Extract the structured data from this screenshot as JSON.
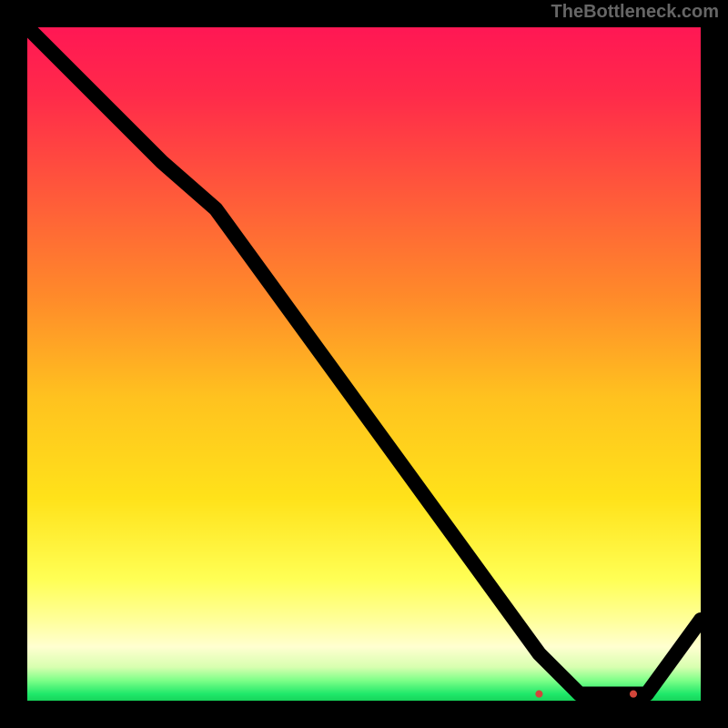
{
  "watermark": "TheBottleneck.com",
  "chart_data": {
    "type": "line",
    "title": "",
    "xlabel": "",
    "ylabel": "",
    "xlim": [
      0,
      100
    ],
    "ylim": [
      0,
      100
    ],
    "grid": false,
    "legend": false,
    "series": [
      {
        "name": "curve",
        "x": [
          0,
          10,
          20,
          28,
          36,
          44,
          52,
          60,
          68,
          76,
          82,
          88,
          92,
          100
        ],
        "y": [
          100,
          90,
          80,
          73,
          62,
          51,
          40,
          29,
          18,
          7,
          1,
          1,
          1,
          12
        ]
      }
    ],
    "annotations": [
      {
        "type": "marker-run",
        "name": "bottom-marker-cluster",
        "y": 1,
        "x_start": 76,
        "x_end": 90,
        "count_dots": 2,
        "label": ""
      }
    ],
    "background": {
      "type": "vertical-gradient",
      "stops": [
        {
          "pos": 0.0,
          "color": "#ff1754"
        },
        {
          "pos": 0.4,
          "color": "#ff8a2a"
        },
        {
          "pos": 0.7,
          "color": "#ffe21a"
        },
        {
          "pos": 0.9,
          "color": "#ffffc0"
        },
        {
          "pos": 1.0,
          "color": "#17d45a"
        }
      ]
    }
  }
}
